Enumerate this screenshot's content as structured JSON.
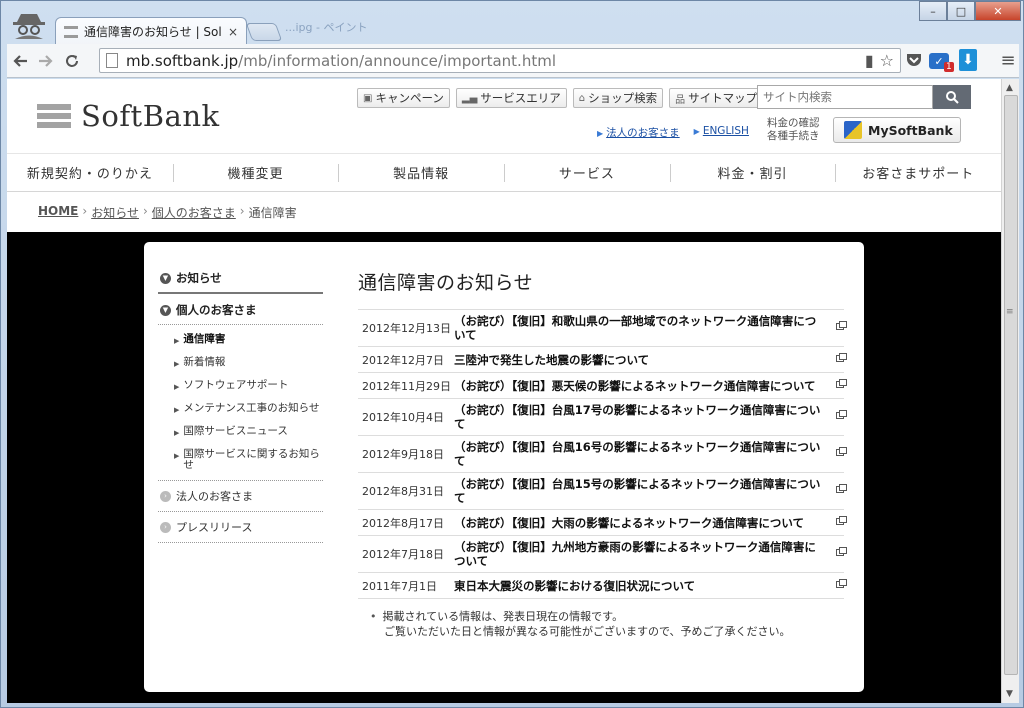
{
  "browser": {
    "tab_title": "通信障害のお知らせ | Sol",
    "tab_close": "×",
    "ghost_tab": "...ipg - ペイント",
    "url_host": "mb.softbank.jp",
    "url_path": "/mb/information/announce/important.html",
    "win_min": "–",
    "win_max": "□",
    "win_close": "✕",
    "mail_badge": "1"
  },
  "header": {
    "logo_text": "SoftBank",
    "quick_links": [
      "キャンペーン",
      "サービスエリア",
      "ショップ検索",
      "サイトマップ"
    ],
    "search_placeholder": "サイト内検索",
    "corp_link": "法人のお客さま",
    "english_link": "ENGLISH",
    "fee_note_1": "料金の確認",
    "fee_note_2": "各種手続き",
    "mysoftbank": "MySoftBank"
  },
  "gnav": [
    "新規契約・のりかえ",
    "機種変更",
    "製品情報",
    "サービス",
    "料金・割引",
    "お客さまサポート"
  ],
  "breadcrumb": {
    "home": "HOME",
    "b1": "お知らせ",
    "b2": "個人のお客さま",
    "current": "通信障害",
    "sep": "›"
  },
  "sidenav": {
    "head1": "お知らせ",
    "head2": "個人のお客さま",
    "sub_items": [
      "通信障害",
      "新着情報",
      "ソフトウェアサポート",
      "メンテナンス工事のお知らせ",
      "国際サービスニュース",
      "国際サービスに関するお知らせ"
    ],
    "corp": "法人のお客さま",
    "press": "プレスリリース"
  },
  "main": {
    "title": "通信障害のお知らせ",
    "news": [
      {
        "date": "2012年12月13日",
        "text": "（お詫び）【復旧】和歌山県の一部地域でのネットワーク通信障害について"
      },
      {
        "date": "2012年12月7日",
        "text": "三陸沖で発生した地震の影響について"
      },
      {
        "date": "2012年11月29日",
        "text": "（お詫び）【復旧】悪天候の影響によるネットワーク通信障害について"
      },
      {
        "date": "2012年10月4日",
        "text": "（お詫び）【復旧】台風17号の影響によるネットワーク通信障害について"
      },
      {
        "date": "2012年9月18日",
        "text": "（お詫び）【復旧】台風16号の影響によるネットワーク通信障害について"
      },
      {
        "date": "2012年8月31日",
        "text": "（お詫び）【復旧】台風15号の影響によるネットワーク通信障害について"
      },
      {
        "date": "2012年8月17日",
        "text": "（お詫び）【復旧】大雨の影響によるネットワーク通信障害について"
      },
      {
        "date": "2012年7月18日",
        "text": "（お詫び）【復旧】九州地方豪雨の影響によるネットワーク通信障害について"
      },
      {
        "date": "2011年7月1日",
        "text": "東日本大震災の影響における復旧状況について"
      }
    ],
    "note_1": "掲載されている情報は、発表日現在の情報です。",
    "note_2": "ご覧いただいた日と情報が異なる可能性がございますので、予めご了承ください。"
  }
}
